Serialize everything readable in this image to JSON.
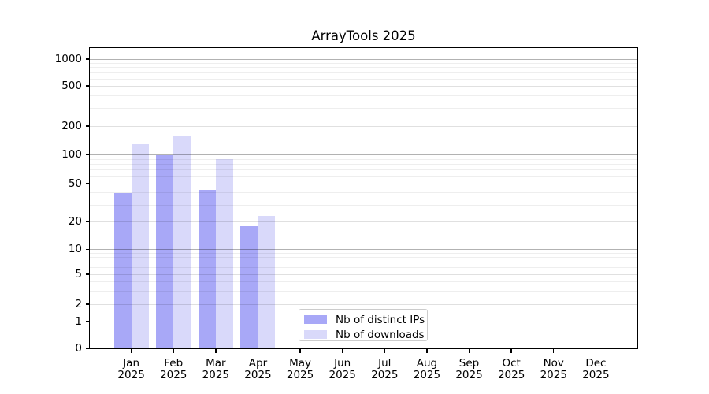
{
  "figure": {
    "background": "#ffffff"
  },
  "chart_data": {
    "type": "bar",
    "title": "ArrayTools 2025",
    "x_categories": [
      {
        "month": "Jan",
        "year": "2025"
      },
      {
        "month": "Feb",
        "year": "2025"
      },
      {
        "month": "Mar",
        "year": "2025"
      },
      {
        "month": "Apr",
        "year": "2025"
      },
      {
        "month": "May",
        "year": "2025"
      },
      {
        "month": "Jun",
        "year": "2025"
      },
      {
        "month": "Jul",
        "year": "2025"
      },
      {
        "month": "Aug",
        "year": "2025"
      },
      {
        "month": "Sep",
        "year": "2025"
      },
      {
        "month": "Oct",
        "year": "2025"
      },
      {
        "month": "Nov",
        "year": "2025"
      },
      {
        "month": "Dec",
        "year": "2025"
      }
    ],
    "y_scale": "symlog",
    "y_ticks": [
      0,
      1,
      2,
      5,
      10,
      20,
      50,
      100,
      200,
      500,
      1000
    ],
    "y_minor_gridlines": [
      3,
      4,
      6,
      7,
      8,
      9,
      30,
      40,
      60,
      70,
      80,
      90,
      300,
      400,
      600,
      700,
      800,
      900
    ],
    "grid": true,
    "legend_position": "lower center inside plot",
    "series": [
      {
        "name": "Nb of distinct IPs",
        "color": "#a8a8f7",
        "values": [
          40,
          100,
          43,
          18,
          null,
          null,
          null,
          null,
          null,
          null,
          null,
          null
        ]
      },
      {
        "name": "Nb of downloads",
        "color": "#d9d9fa",
        "values": [
          130,
          160,
          90,
          23,
          null,
          null,
          null,
          null,
          null,
          null,
          null,
          null
        ]
      }
    ]
  }
}
